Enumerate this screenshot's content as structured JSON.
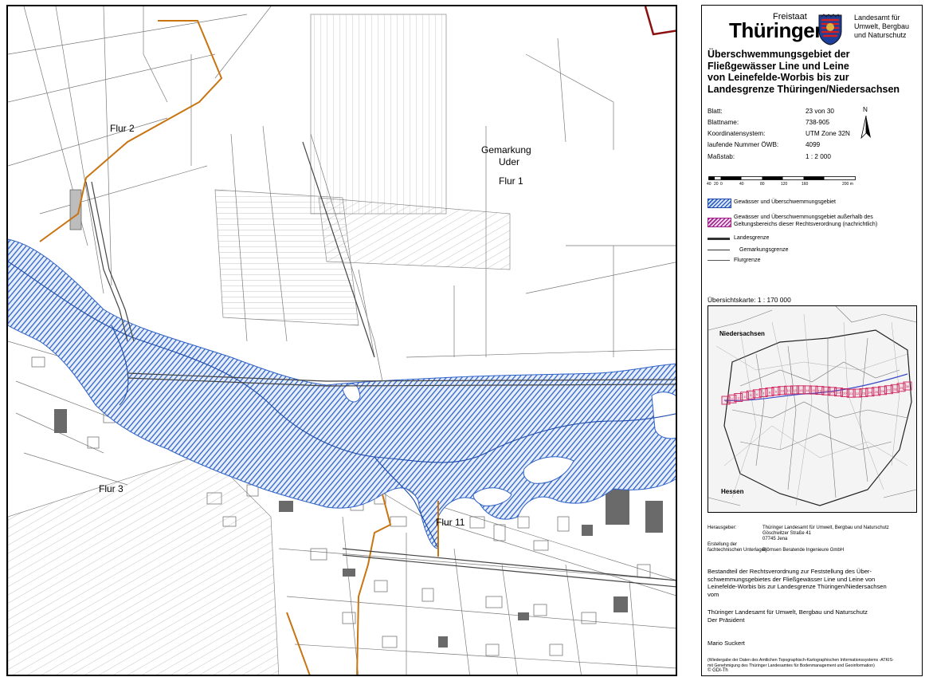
{
  "map": {
    "labels": {
      "flur2": "Flur 2",
      "gemarkung": "Gemarkung",
      "uder": "Uder",
      "flur1": "Flur 1",
      "flur3": "Flur 3",
      "flur11": "Flur 11"
    },
    "colors": {
      "flood_hatch": "#2f62c7",
      "flood_fill": "#e6eefb",
      "boundary_orange": "#c87410",
      "land_boundary": "#8a1010",
      "lines": "#666666"
    }
  },
  "header": {
    "freistaat": "Freistaat",
    "thueringen": "Thüringen",
    "agency": [
      "Landesamt für",
      "Umwelt, Bergbau",
      "und Naturschutz"
    ],
    "crest_icon": "thuringia-coat-of-arms-icon"
  },
  "title": [
    "Überschwemmungsgebiet der",
    "Fließgewässer Line und Leine",
    "von Leinefelde-Worbis bis zur",
    "Landesgrenze Thüringen/Niedersachsen"
  ],
  "info": {
    "rows": [
      {
        "label": "Blatt:",
        "value": "23 von 30"
      },
      {
        "label": "Blattname:",
        "value": "738-905"
      },
      {
        "label": "Koordinatensystem:",
        "value": "UTM Zone 32N"
      },
      {
        "label": "laufende Nummer ÖWB:",
        "value": "4099"
      },
      {
        "label": "Maßstab:",
        "value": "1 : 2 000"
      }
    ],
    "north_label": "N"
  },
  "scalebar": {
    "ticks": [
      "40",
      "20",
      "0",
      "40",
      "80",
      "120",
      "160",
      "200 m"
    ]
  },
  "legend": {
    "items": [
      {
        "symbol": "blue-hatch",
        "text": "Gewässer und Überschwemmungsgebiet"
      },
      {
        "symbol": "purple-hatch",
        "text": "Gewässer und Überschwemmungsgebiet außerhalb des Geltungsbereichs dieser Rechtsverordnung (nachrichtlich)"
      },
      {
        "symbol": "land-border-line",
        "text": "Landesgrenze"
      },
      {
        "symbol": "district-border-line",
        "text": "Gemarkungsgrenze"
      },
      {
        "symbol": "parcel-border-line",
        "text": "Flurgrenze"
      }
    ]
  },
  "overview": {
    "title": "Übersichtskarte:  1 : 170 000",
    "niedersachsen": "Niedersachsen",
    "hessen": "Hessen",
    "sheet_numbers": [
      "1",
      "2",
      "3",
      "4",
      "5",
      "6",
      "7",
      "8",
      "9",
      "10",
      "11",
      "12",
      "13",
      "14",
      "15",
      "16",
      "17",
      "18",
      "19",
      "20",
      "21",
      "22",
      "23",
      "24",
      "25",
      "26",
      "27",
      "28",
      "29",
      "30"
    ],
    "colors": {
      "sheets": "#d0205a",
      "river": "#3a49c8",
      "roads": "#888888"
    }
  },
  "imprint": {
    "herausgeber_label": "Herausgeber:",
    "herausgeber_value": [
      "Thüringer Landesamt für Umwelt, Bergbau und Naturschutz",
      "Göschwitzer Straße 41",
      "07745 Jena"
    ],
    "erstellung_label": [
      "Erstellung der",
      "fachtechnischen Unterlagen:"
    ],
    "erstellung_value": "Björnsen Beratende Ingenieure GmbH"
  },
  "statement": [
    "Bestandteil der Rechtsverordnung zur Feststellung des Über-",
    "schwemmungsgebietes der Fließgewässer Line und Leine von",
    "Leinefelde-Worbis bis zur Landesgrenze Thüringen/Niedersachsen",
    "vom"
  ],
  "authority": [
    "Thüringer Landesamt für Umwelt, Bergbau und Naturschutz",
    "Der Präsident"
  ],
  "signature_name": "Mario Suckert",
  "footnote": [
    "(Wiedergabe der Daten des Amtlichen Topographisch-Kartographischen Informationssystems -ATKIS-",
    "mit Genehmigung des Thüringer Landesamtes für Bodenmanagement und Geoinformation)",
    "© GDI-Th"
  ]
}
